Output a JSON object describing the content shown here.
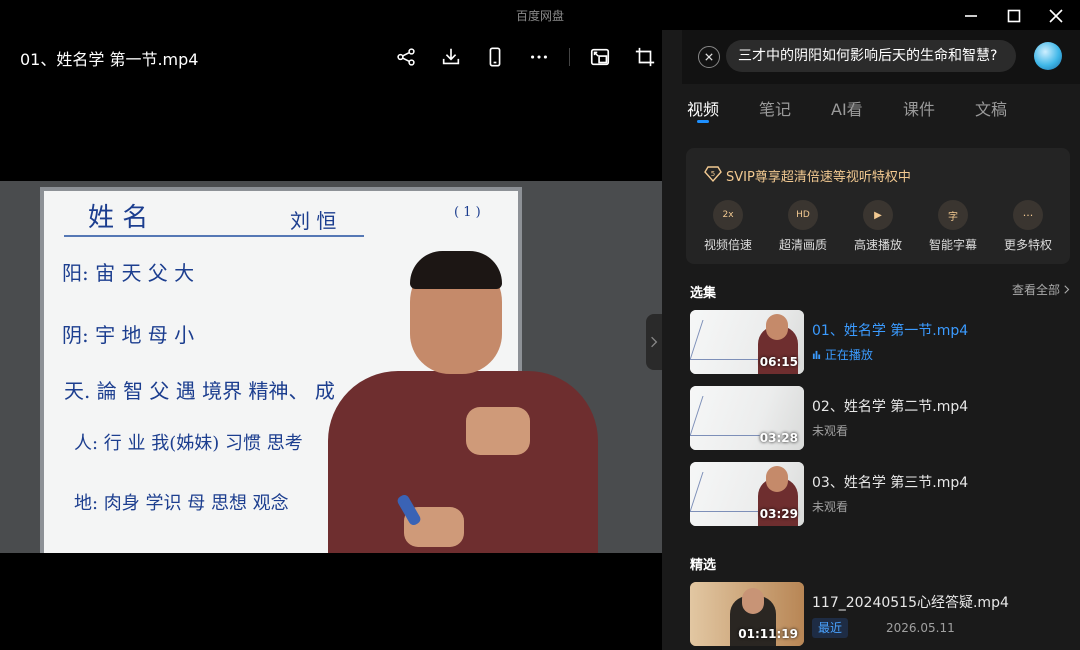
{
  "window": {
    "app_title": "百度网盘"
  },
  "player": {
    "file_title": "01、姓名学 第一节.mp4",
    "toolbar": {
      "share_icon": "share-icon",
      "download_icon": "download-icon",
      "phone_icon": "phone-icon",
      "more_icon": "more-icon",
      "pip_icon": "picture-in-picture-icon",
      "crop_icon": "crop-icon"
    },
    "board_text": {
      "title": "姓 名",
      "name": "刘 恒",
      "page": "( 1 )",
      "line1": "阳: 宙 天 父 大",
      "line2": "阴: 宇 地 母 小",
      "line3": "天. 論 智 父    遇 境界 精神、 成",
      "line4": "人: 行 业    我(姊妹) 习惯 思考",
      "line5": "地: 肉身 学识 母    思想 观念"
    }
  },
  "assistant": {
    "question": "三才中的阴阳如何影响后天的生命和智慧?"
  },
  "tabs": [
    {
      "label": "视频",
      "active": true
    },
    {
      "label": "笔记",
      "active": false
    },
    {
      "label": "AI看",
      "active": false
    },
    {
      "label": "课件",
      "active": false
    },
    {
      "label": "文稿",
      "active": false
    }
  ],
  "svip": {
    "badge": "5",
    "title": "SVIP尊享超清倍速等视听特权中",
    "perks": [
      {
        "label": "视频倍速",
        "glyph": "2x"
      },
      {
        "label": "超清画质",
        "glyph": "HD"
      },
      {
        "label": "高速播放",
        "glyph": "▶"
      },
      {
        "label": "智能字幕",
        "glyph": "字"
      },
      {
        "label": "更多特权",
        "glyph": "···"
      }
    ]
  },
  "episodes": {
    "section_title": "选集",
    "see_all": "查看全部",
    "items": [
      {
        "title": "01、姓名学 第一节.mp4",
        "duration": "06:15",
        "status": "正在播放",
        "playing": true
      },
      {
        "title": "02、姓名学 第二节.mp4",
        "duration": "03:28",
        "status": "未观看",
        "playing": false
      },
      {
        "title": "03、姓名学 第三节.mp4",
        "duration": "03:29",
        "status": "未观看",
        "playing": false
      }
    ]
  },
  "featured": {
    "section_title": "精选",
    "items": [
      {
        "title": "117_20240515心经答疑.mp4",
        "duration": "01:11:19",
        "badge": "最近",
        "date": "2026.05.11"
      }
    ]
  },
  "colors": {
    "accent": "#3b9bff",
    "svip_gold": "#f2c991",
    "panel_bg": "#1a1a1a"
  }
}
